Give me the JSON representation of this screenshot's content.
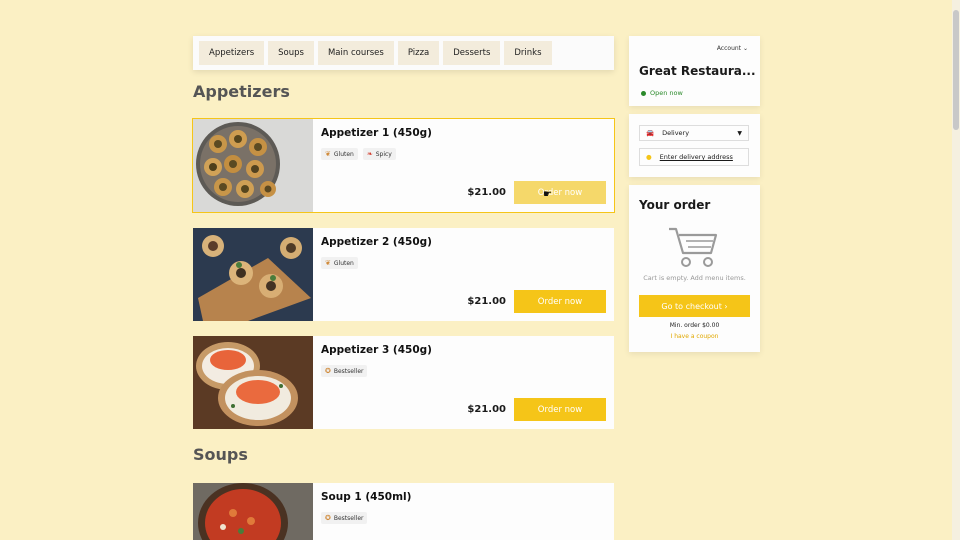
{
  "nav": {
    "tabs": [
      "Appetizers",
      "Soups",
      "Main courses",
      "Pizza",
      "Desserts",
      "Drinks"
    ]
  },
  "sections": {
    "appetizers": "Appetizers",
    "soups": "Soups"
  },
  "items": [
    {
      "title": "Appetizer 1 (450g)",
      "tags": [
        "Gluten",
        "Spicy"
      ],
      "price": "$21.00",
      "button": "Order now"
    },
    {
      "title": "Appetizer 2 (450g)",
      "tags": [
        "Gluten"
      ],
      "price": "$21.00",
      "button": "Order now"
    },
    {
      "title": "Appetizer 3 (450g)",
      "tags": [
        "Bestseller"
      ],
      "price": "$21.00",
      "button": "Order now"
    },
    {
      "title": "Soup 1 (450ml)",
      "tags": [
        "Bestseller"
      ]
    }
  ],
  "restaurant": {
    "account": "Account",
    "name": "Great Restaura...",
    "status": "Open now"
  },
  "delivery": {
    "mode": "Delivery",
    "address_prompt": "Enter delivery address"
  },
  "order": {
    "title": "Your order",
    "empty_text": "Cart is empty. Add menu items.",
    "checkout": "Go to checkout ›",
    "min_order": "Min. order $0.00",
    "coupon": "I have a coupon"
  },
  "colors": {
    "background": "#fbf0c4",
    "accent": "#f5c518",
    "open_status": "#2b8a2b"
  }
}
